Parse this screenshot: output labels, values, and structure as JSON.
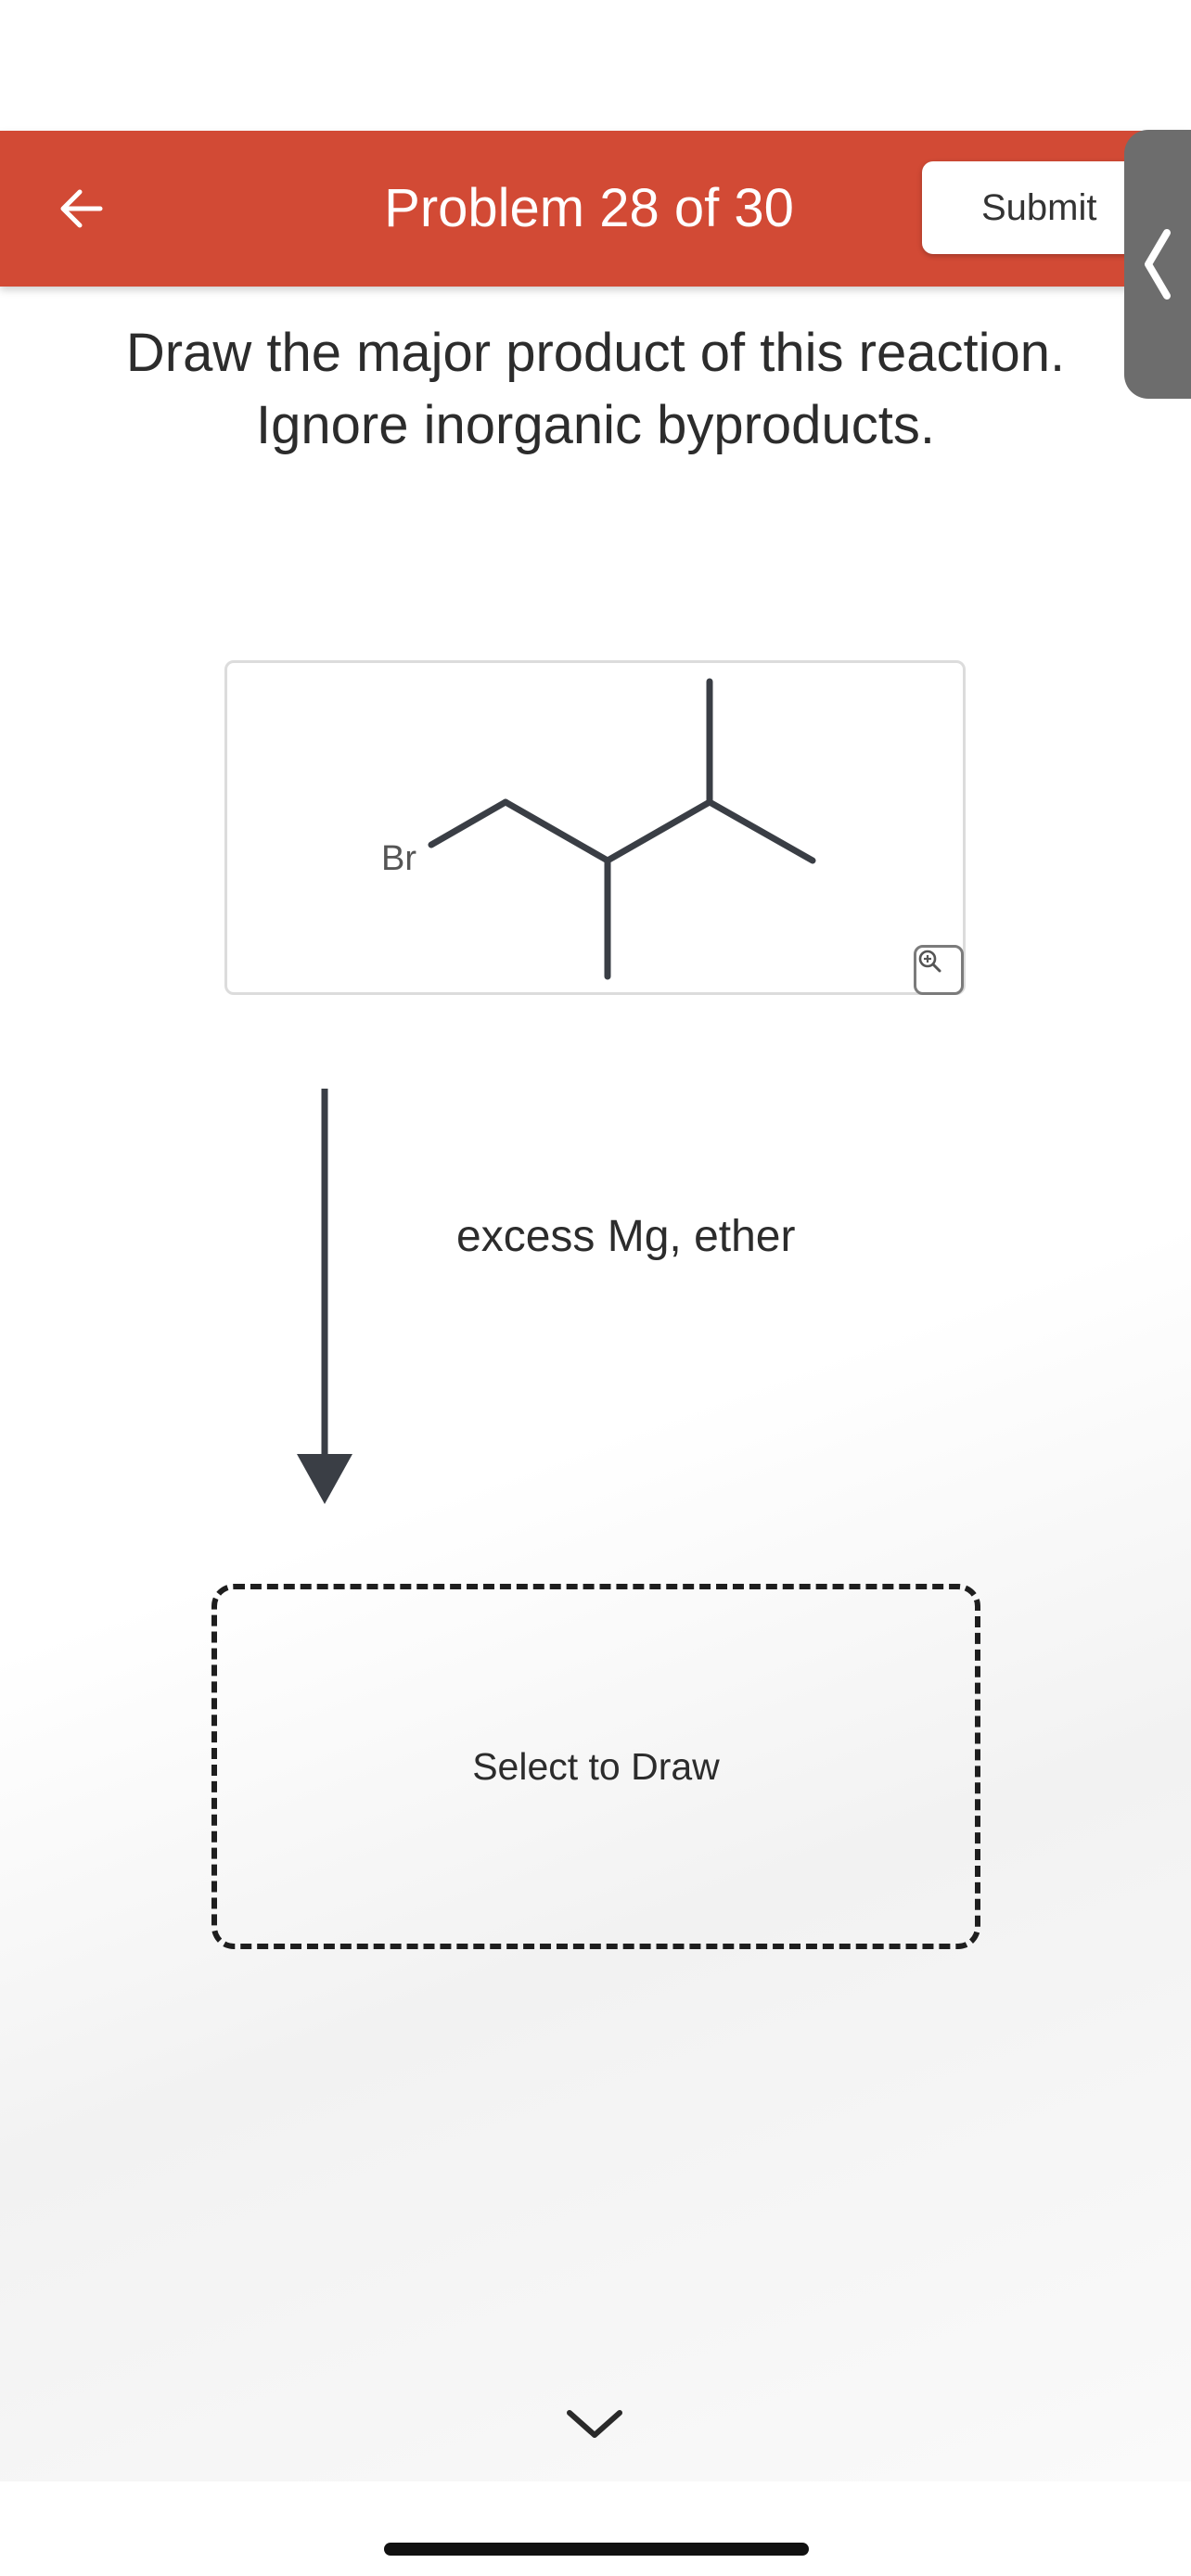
{
  "header": {
    "back_icon": "arrow-left-icon",
    "title": "Problem 28 of 30",
    "submit_label": "Submit",
    "color": "#d24a35"
  },
  "side_handle": {
    "icon": "chevron-left-icon"
  },
  "question": {
    "line1": "Draw the major product of this reaction.",
    "line2": "Ignore inorganic byproducts."
  },
  "reactant": {
    "atom_label": "Br",
    "zoom_icon": "zoom-in-icon"
  },
  "reagents": "excess Mg, ether",
  "answer": {
    "prompt": "Select to Draw"
  },
  "footer": {
    "scroll_icon": "chevron-down-icon"
  }
}
